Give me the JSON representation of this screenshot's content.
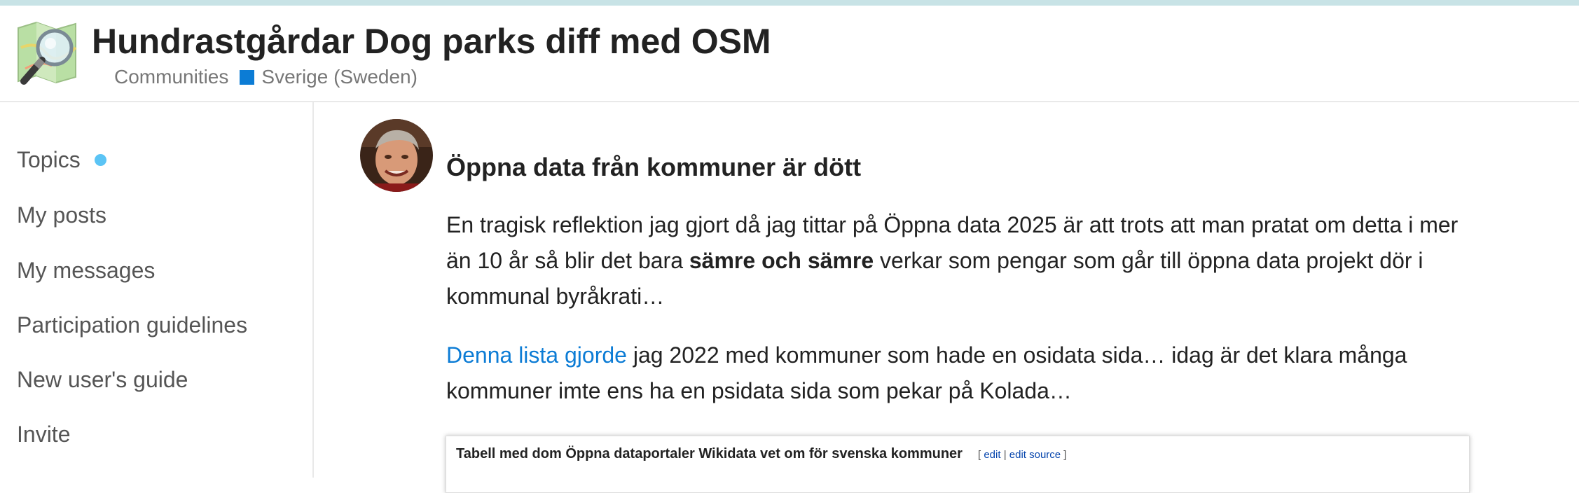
{
  "header": {
    "title": "Hundrastgårdar Dog parks diff med OSM",
    "breadcrumb": {
      "parent": "Communities",
      "category": "Sverige (Sweden)",
      "category_color": "#0c7cd5"
    },
    "logo_icon": "openstreetmap-magnifier-logo"
  },
  "sidebar": {
    "items": [
      {
        "label": "Topics",
        "unread_dot": true
      },
      {
        "label": "My posts"
      },
      {
        "label": "My messages"
      },
      {
        "label": "Participation guidelines"
      },
      {
        "label": "New user's guide"
      },
      {
        "label": "Invite"
      }
    ],
    "unread_dot_color": "#5bc4f5"
  },
  "post": {
    "title": "Öppna data från kommuner är dött",
    "avatar_icon": "user-avatar",
    "p1_a": "En tragisk reflektion jag gjort då jag tittar på Öppna data 2025 är att trots att man pratat om detta i mer än 10 år så blir det bara ",
    "p1_bold": "sämre och sämre",
    "p1_b": " verkar som pengar som går till öppna data projekt dör i kommunal byråkrati…",
    "p2_link": "Denna lista gjorde",
    "p2_rest": " jag 2022 med kommuner som hade en osidata sida… idag är det klara många kommuner imte ens ha en psidata sida som pekar på Kolada…",
    "link_color": "#0c7cd5"
  },
  "embed": {
    "title": "Tabell med dom Öppna dataportaler Wikidata vet om för svenska kommuner",
    "bracket_open": "[ ",
    "edit_label": "edit",
    "separator": " | ",
    "edit_source_label": "edit source",
    "bracket_close": " ]"
  }
}
